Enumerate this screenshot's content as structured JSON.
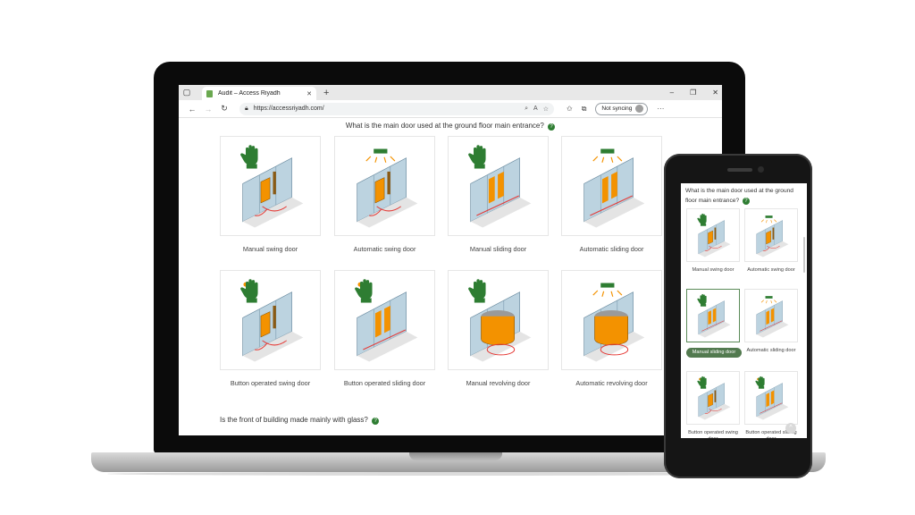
{
  "browser": {
    "tab_title": "Audit – Access Riyadh",
    "tab_close": "✕",
    "new_tab": "+",
    "url": "https://accessriyadh.com/",
    "sync_label": "Not syncing",
    "window_controls": [
      "–",
      "❐",
      "✕"
    ]
  },
  "page": {
    "question1": "What is the main door used at the ground floor main entrance?",
    "help": "?",
    "question2": "Is the front of building made mainly with glass?",
    "door_options": [
      {
        "label": "Manual swing door",
        "icon": "hand-icon",
        "type": "swing"
      },
      {
        "label": "Automatic swing door",
        "icon": "sensor-icon",
        "type": "swing"
      },
      {
        "label": "Manual sliding door",
        "icon": "hand-icon",
        "type": "sliding"
      },
      {
        "label": "Automatic sliding door",
        "icon": "sensor-icon",
        "type": "sliding"
      },
      {
        "label": "Button operated swing door",
        "icon": "button-hand-icon",
        "type": "swing"
      },
      {
        "label": "Button operated sliding door",
        "icon": "button-hand-icon",
        "type": "sliding"
      },
      {
        "label": "Manual revolving door",
        "icon": "hand-icon",
        "type": "revolving"
      },
      {
        "label": "Automatic revolving door",
        "icon": "sensor-icon",
        "type": "revolving"
      }
    ]
  },
  "phone": {
    "question": "What is the main door used at the ground floor main entrance?",
    "selected_label": "Manual sliding door",
    "back_to_top": "^"
  },
  "colors": {
    "accent_green": "#2e7d32",
    "door_orange": "#f39200",
    "wall_blue": "#9fb8c8",
    "arrow_red": "#e53935"
  }
}
